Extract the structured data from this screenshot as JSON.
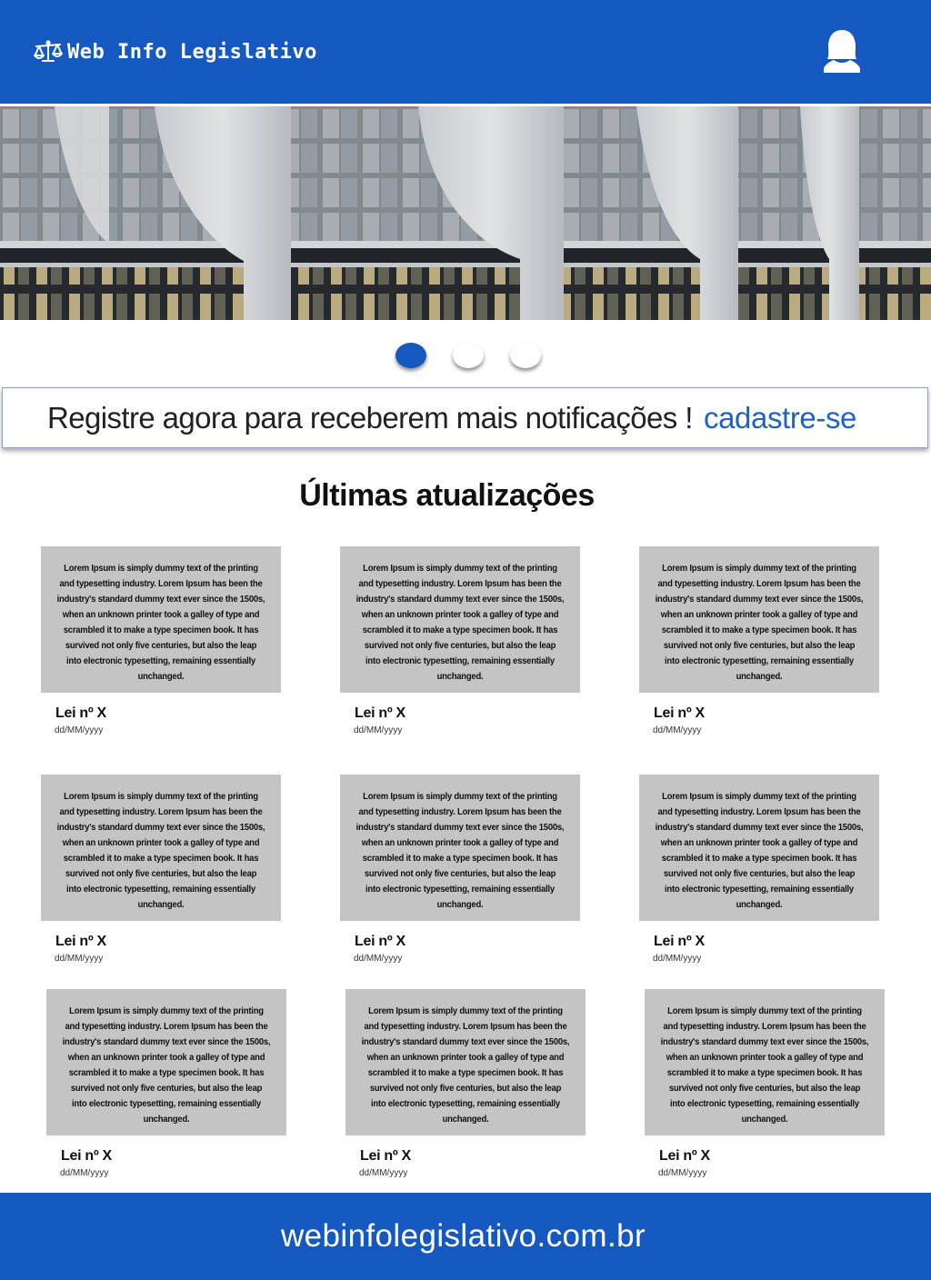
{
  "header": {
    "app_title": "Web Info Legislativo",
    "logo_icon": "scales-icon",
    "user_icon": "user-icon",
    "color": "#1558c0"
  },
  "carousel": {
    "slide_count": 3,
    "active_index": 0
  },
  "register_banner": {
    "text": "Registre agora para receberem mais notificações !",
    "link_label": "cadastre-se"
  },
  "updates": {
    "title": "Últimas atualizações",
    "items": [
      {
        "body": "Lorem Ipsum is simply dummy text of the printing and typesetting industry. Lorem Ipsum has been the industry's standard dummy text ever since the 1500s, when an unknown printer took a galley of type and scrambled it to make a type specimen book. It has survived not only five centuries, but also the leap into electronic typesetting, remaining essentially unchanged.",
        "title": "Lei nº X",
        "date": "dd/MM/yyyy"
      },
      {
        "body": "Lorem Ipsum is simply dummy text of the printing and typesetting industry. Lorem Ipsum has been the industry's standard dummy text ever since the 1500s, when an unknown printer took a galley of type and scrambled it to make a type specimen book. It has survived not only five centuries, but also the leap into electronic typesetting, remaining essentially unchanged.",
        "title": "Lei nº X",
        "date": "dd/MM/yyyy"
      },
      {
        "body": "Lorem Ipsum is simply dummy text of the printing and typesetting industry. Lorem Ipsum has been the industry's standard dummy text ever since the 1500s, when an unknown printer took a galley of type and scrambled it to make a type specimen book. It has survived not only five centuries, but also the leap into electronic typesetting, remaining essentially unchanged.",
        "title": "Lei nº X",
        "date": "dd/MM/yyyy"
      },
      {
        "body": "Lorem Ipsum is simply dummy text of the printing and typesetting industry. Lorem Ipsum has been the industry's standard dummy text ever since the 1500s, when an unknown printer took a galley of type and scrambled it to make a type specimen book. It has survived not only five centuries, but also the leap into electronic typesetting, remaining essentially unchanged.",
        "title": "Lei nº X",
        "date": "dd/MM/yyyy"
      },
      {
        "body": "Lorem Ipsum is simply dummy text of the printing and typesetting industry. Lorem Ipsum has been the industry's standard dummy text ever since the 1500s, when an unknown printer took a galley of type and scrambled it to make a type specimen book. It has survived not only five centuries, but also the leap into electronic typesetting, remaining essentially unchanged.",
        "title": "Lei nº X",
        "date": "dd/MM/yyyy"
      },
      {
        "body": "Lorem Ipsum is simply dummy text of the printing and typesetting industry. Lorem Ipsum has been the industry's standard dummy text ever since the 1500s, when an unknown printer took a galley of type and scrambled it to make a type specimen book. It has survived not only five centuries, but also the leap into electronic typesetting, remaining essentially unchanged.",
        "title": "Lei nº X",
        "date": "dd/MM/yyyy"
      },
      {
        "body": "Lorem Ipsum is simply dummy text of the printing and typesetting industry. Lorem Ipsum has been the industry's standard dummy text ever since the 1500s, when an unknown printer took a galley of type and scrambled it to make a type specimen book. It has survived not only five centuries, but also the leap into electronic typesetting, remaining essentially unchanged.",
        "title": "Lei nº X",
        "date": "dd/MM/yyyy"
      },
      {
        "body": "Lorem Ipsum is simply dummy text of the printing and typesetting industry. Lorem Ipsum has been the industry's standard dummy text ever since the 1500s, when an unknown printer took a galley of type and scrambled it to make a type specimen book. It has survived not only five centuries, but also the leap into electronic typesetting, remaining essentially unchanged.",
        "title": "Lei nº X",
        "date": "dd/MM/yyyy"
      },
      {
        "body": "Lorem Ipsum is simply dummy text of the printing and typesetting industry. Lorem Ipsum has been the industry's standard dummy text ever since the 1500s, when an unknown printer took a galley of type and scrambled it to make a type specimen book. It has survived not only five centuries, but also the leap into electronic typesetting, remaining essentially unchanged.",
        "title": "Lei nº X",
        "date": "dd/MM/yyyy"
      }
    ]
  },
  "footer": {
    "url": "webinfolegislativo.com.br"
  }
}
